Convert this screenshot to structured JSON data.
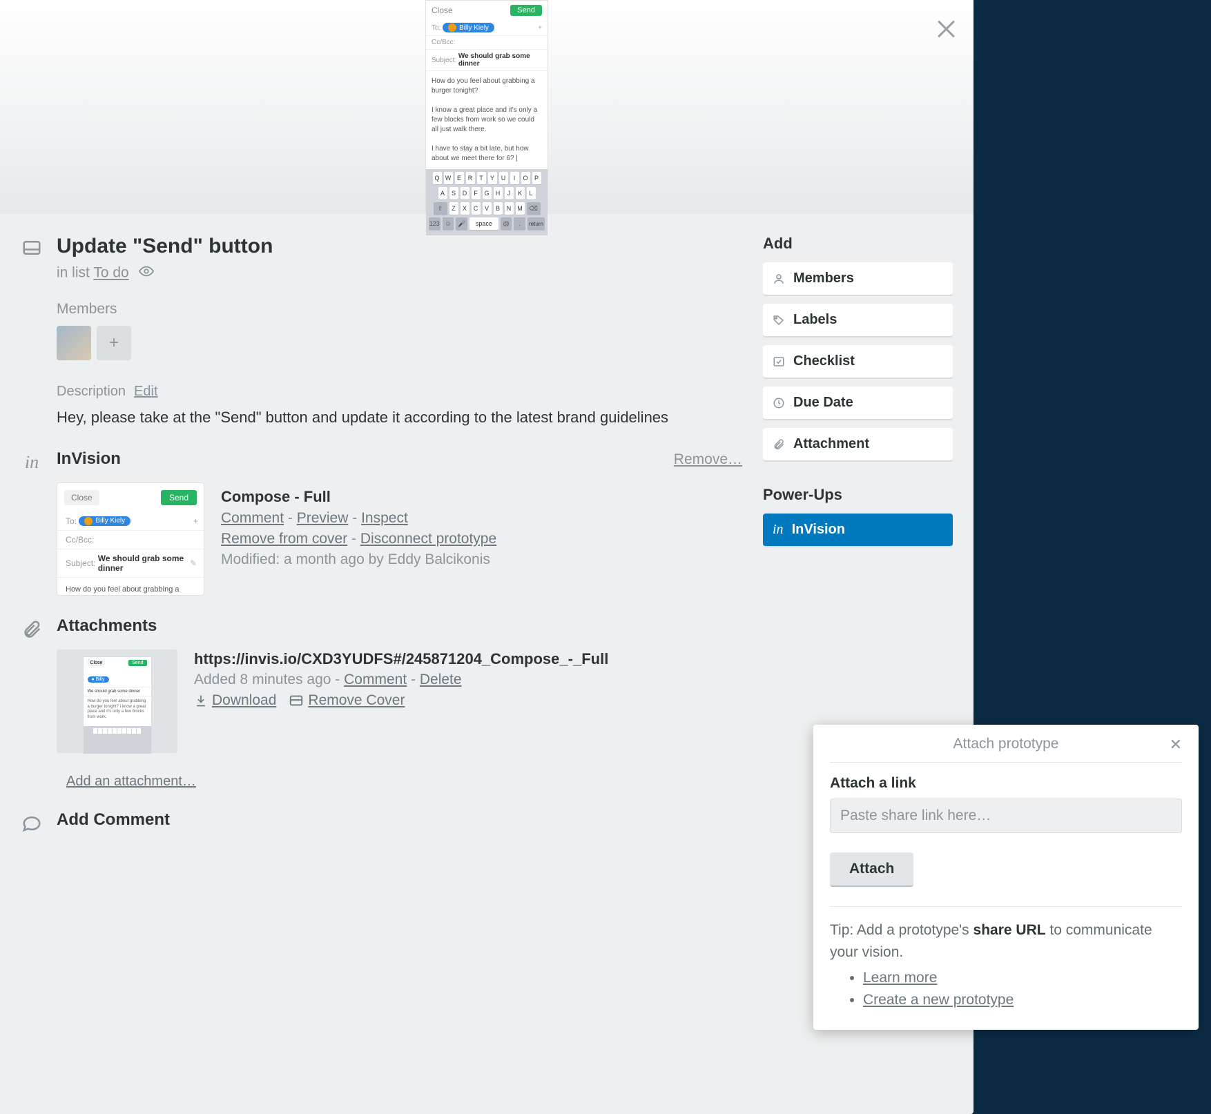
{
  "cover": {
    "close": "Close",
    "send": "Send",
    "to": "To:",
    "recipient": "Billy Kiely",
    "ccbcc": "Cc/Bcc:",
    "subject_label": "Subject:",
    "subject": "We should grab some dinner",
    "body1": "How do you feel about grabbing a burger tonight?",
    "body2": "I know a great place and it's only a few blocks from work so we could all just walk there.",
    "body3": "I have to stay a bit late, but how about we meet there for 6? |"
  },
  "card": {
    "title": "Update \"Send\" button",
    "in_list": "in list ",
    "list_name": "To do"
  },
  "members": {
    "label": "Members"
  },
  "description": {
    "label": "Description",
    "edit": "Edit",
    "text": "Hey, please take at the \"Send\" button and update it according to the latest brand guidelines"
  },
  "invision": {
    "heading": "InVision",
    "remove": "Remove…",
    "item": {
      "title": "Compose - Full",
      "comment": "Comment",
      "preview": "Preview",
      "inspect": "Inspect",
      "remove_cover": "Remove from cover",
      "disconnect": "Disconnect prototype",
      "modified": "Modified: a month ago by Eddy Balcikonis"
    }
  },
  "attachments": {
    "heading": "Attachments",
    "item": {
      "title": "https://invis.io/CXD3YUDFS#/245871204_Compose_-_Full",
      "added": "Added 8 minutes ago - ",
      "comment": "Comment",
      "delete": "Delete",
      "download": "Download",
      "remove_cover": "Remove Cover"
    },
    "add": "Add an attachment…"
  },
  "add_comment": {
    "heading": "Add Comment"
  },
  "sidebar": {
    "add_heading": "Add",
    "members": "Members",
    "labels": "Labels",
    "checklist": "Checklist",
    "due_date": "Due Date",
    "attachment": "Attachment",
    "powerups_heading": "Power-Ups",
    "invision": "InVision"
  },
  "popup": {
    "title": "Attach prototype",
    "label": "Attach a link",
    "placeholder": "Paste share link here…",
    "button": "Attach",
    "tip_prefix": "Tip: Add a prototype's ",
    "tip_bold": "share URL",
    "tip_suffix": " to communicate your vision.",
    "learn": "Learn more",
    "create": "Create a new prototype"
  }
}
